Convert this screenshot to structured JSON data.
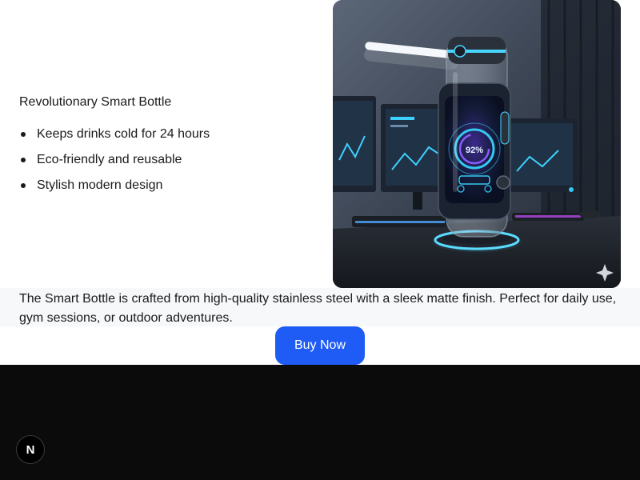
{
  "hero": {
    "title": "Revolutionary Smart Bottle",
    "features": [
      "Keeps drinks cold for 24 hours",
      "Eco-friendly and reusable",
      "Stylish modern design"
    ],
    "image": {
      "display_reading": "92%",
      "icon": "sparkle-icon"
    }
  },
  "description": {
    "text": "The Smart Bottle is crafted from high-quality stainless steel with a sleek matte finish. Perfect for daily use, gym sessions, or outdoor adventures."
  },
  "cta": {
    "label": "Buy Now"
  },
  "footer": {
    "badge_letter": "N",
    "badge_icon": "n-logo-icon"
  },
  "colors": {
    "accent": "#1e5cf5",
    "footer_bg": "#0b0b0b",
    "band_bg": "#f7f8fa",
    "glow": "#35c8f2"
  }
}
